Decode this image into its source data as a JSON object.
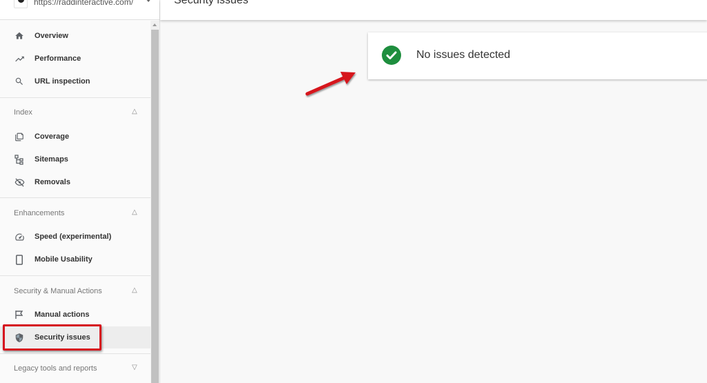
{
  "property": {
    "url": "https://raddinteractive.com/",
    "favicon_icon": "site-favicon",
    "dropdown_icon": "caret-down-icon"
  },
  "sidebar": {
    "top_items": [
      {
        "label": "Overview",
        "icon": "home-icon"
      },
      {
        "label": "Performance",
        "icon": "trending-up-icon"
      },
      {
        "label": "URL inspection",
        "icon": "search-icon"
      }
    ],
    "sections": [
      {
        "title": "Index",
        "expanded": true,
        "items": [
          {
            "label": "Coverage",
            "icon": "coverage-icon"
          },
          {
            "label": "Sitemaps",
            "icon": "sitemap-icon"
          },
          {
            "label": "Removals",
            "icon": "eye-off-icon"
          }
        ]
      },
      {
        "title": "Enhancements",
        "expanded": true,
        "items": [
          {
            "label": "Speed (experimental)",
            "icon": "speedometer-icon"
          },
          {
            "label": "Mobile Usability",
            "icon": "phone-icon"
          }
        ]
      },
      {
        "title": "Security & Manual Actions",
        "expanded": true,
        "items": [
          {
            "label": "Manual actions",
            "icon": "flag-icon"
          },
          {
            "label": "Security issues",
            "icon": "shield-icon",
            "active": true
          }
        ]
      },
      {
        "title": "Legacy tools and reports",
        "expanded": false,
        "items": []
      }
    ]
  },
  "main": {
    "page_title": "Security issues",
    "status": {
      "text": "No issues detected",
      "icon": "check-circle-icon",
      "color": "#1e8e3e"
    }
  },
  "annotations": {
    "highlight_color": "#d6121e",
    "arrow_color": "#d6121e"
  }
}
